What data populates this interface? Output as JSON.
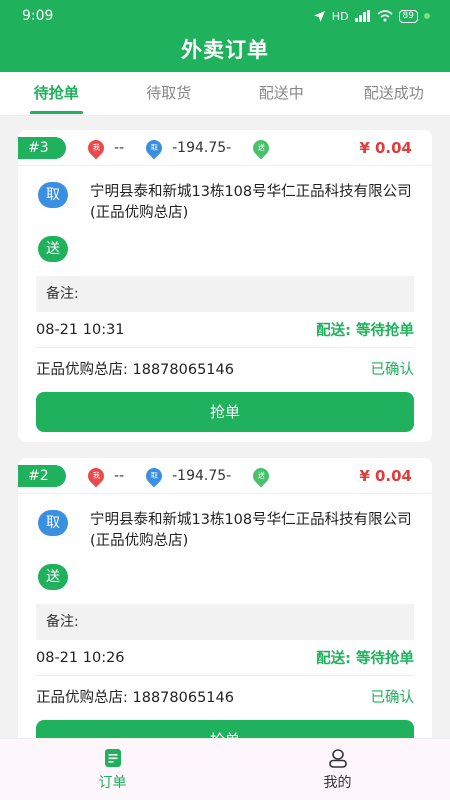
{
  "status": {
    "time": "9:09",
    "network": "HD",
    "battery": "89"
  },
  "app": {
    "title": "外卖订单"
  },
  "tabs": [
    {
      "label": "待抢单",
      "active": true
    },
    {
      "label": "待取货",
      "active": false
    },
    {
      "label": "配送中",
      "active": false
    },
    {
      "label": "配送成功",
      "active": false
    }
  ],
  "orders": [
    {
      "number": "#3",
      "pin_me": "我",
      "pin_pickup": "取",
      "pin_deliver": "送",
      "dist_me": "--",
      "dist_pickup": "-194.75-",
      "price": "¥ 0.04",
      "pickup_badge": "取",
      "pickup_address": "宁明县泰和新城13栋108号华仁正品科技有限公司(正品优购总店)",
      "deliver_badge": "送",
      "deliver_address": "",
      "note": "备注:",
      "time": "08-21 10:31",
      "delivery_status": "配送: 等待抢单",
      "store_contact": "正品优购总店: 18878065146",
      "confirm_status": "已确认",
      "grab_label": "抢单"
    },
    {
      "number": "#2",
      "pin_me": "我",
      "pin_pickup": "取",
      "pin_deliver": "送",
      "dist_me": "--",
      "dist_pickup": "-194.75-",
      "price": "¥ 0.04",
      "pickup_badge": "取",
      "pickup_address": "宁明县泰和新城13栋108号华仁正品科技有限公司(正品优购总店)",
      "deliver_badge": "送",
      "deliver_address": "",
      "note": "备注:",
      "time": "08-21 10:26",
      "delivery_status": "配送: 等待抢单",
      "store_contact": "正品优购总店: 18878065146",
      "confirm_status": "已确认",
      "grab_label": "抢单"
    }
  ],
  "nav": [
    {
      "label": "订单",
      "icon": "order-icon",
      "active": true
    },
    {
      "label": "我的",
      "icon": "user-icon",
      "active": false
    }
  ],
  "colors": {
    "brand": "#1fb15c",
    "price": "#e23b3b",
    "pickup": "#3a8fe0"
  }
}
